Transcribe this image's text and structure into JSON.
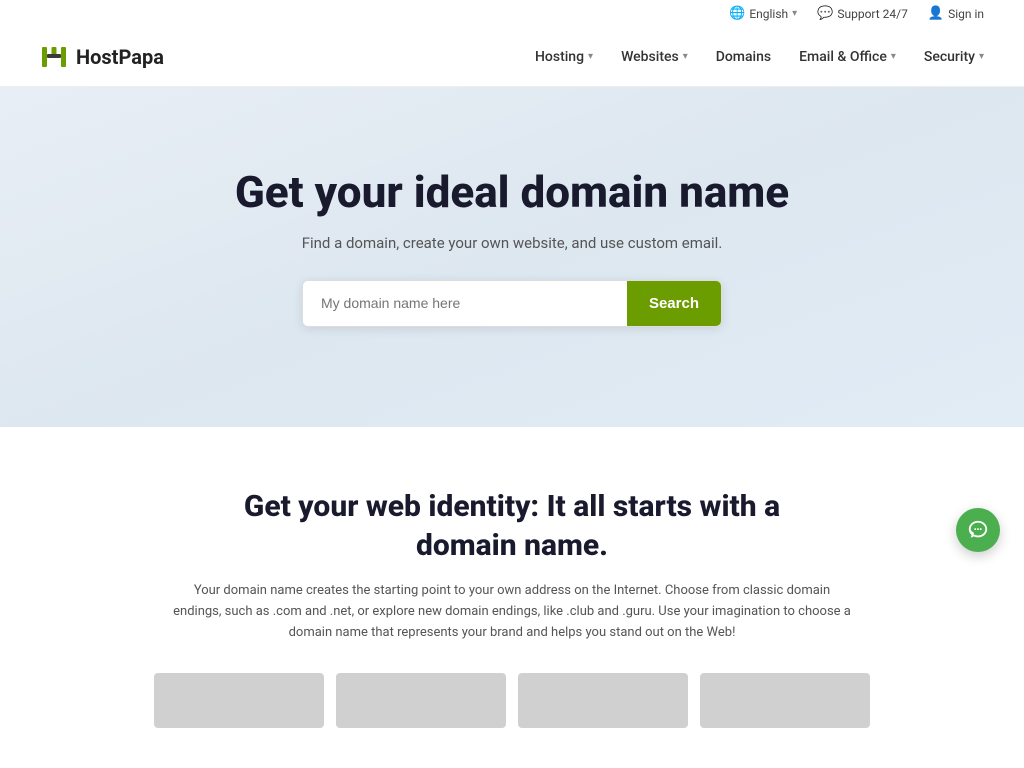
{
  "topbar": {
    "language_label": "English",
    "support_label": "Support 24/7",
    "signin_label": "Sign in"
  },
  "navbar": {
    "logo_text": "HostPapa",
    "nav_items": [
      {
        "id": "hosting",
        "label": "Hosting",
        "has_dropdown": true
      },
      {
        "id": "websites",
        "label": "Websites",
        "has_dropdown": true
      },
      {
        "id": "domains",
        "label": "Domains",
        "has_dropdown": false
      },
      {
        "id": "email-office",
        "label": "Email & Office",
        "has_dropdown": true
      },
      {
        "id": "security",
        "label": "Security",
        "has_dropdown": true
      }
    ]
  },
  "hero": {
    "title": "Get your ideal domain name",
    "subtitle": "Find a domain, create your own website, and use custom email.",
    "search_placeholder": "My domain name here",
    "search_button_label": "Search"
  },
  "lower": {
    "title": "Get your web identity: It all starts with a domain name.",
    "description": "Your domain name creates the starting point to your own address on the Internet. Choose from classic domain endings, such as .com and .net, or explore new domain endings, like .club and .guru. Use your imagination to choose a domain name that represents your brand and helps you stand out on the Web!"
  },
  "colors": {
    "search_button_bg": "#6b9c00",
    "logo_green": "#6b9c00",
    "chat_bg": "#4caf4f"
  }
}
